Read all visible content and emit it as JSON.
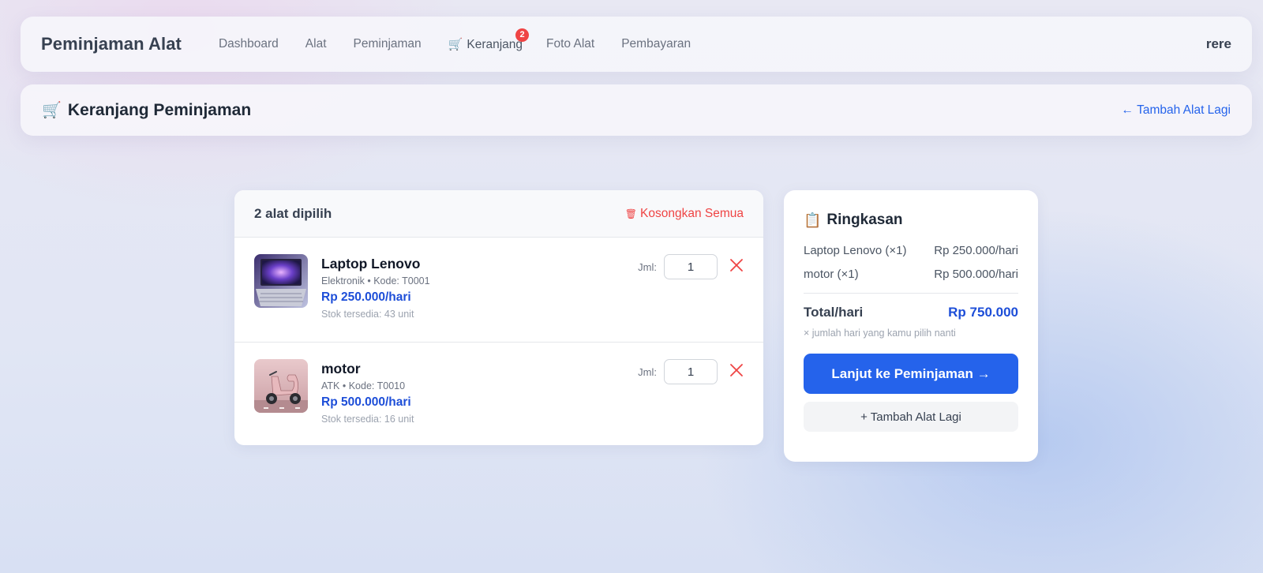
{
  "nav": {
    "brand": "Peminjaman Alat",
    "links": [
      "Dashboard",
      "Alat",
      "Peminjaman",
      "Keranjang",
      "Foto Alat",
      "Pembayaran"
    ],
    "cart_badge": "2",
    "user": "rere",
    "cart_icon": "shopping-cart-icon"
  },
  "page": {
    "title": "Keranjang Peminjaman",
    "back_link": "← Tambah Alat Lagi"
  },
  "cart": {
    "count_label": "2 alat dipilih",
    "clear_label": "Kosongkan Semua",
    "qty_label": "Jml:",
    "items": [
      {
        "name": "Laptop Lenovo",
        "meta": "Elektronik • Kode: T0001",
        "price": "Rp 250.000/hari",
        "stock": "Stok tersedia: 43 unit",
        "qty": "1",
        "image": "laptop-photo"
      },
      {
        "name": "motor",
        "meta": "ATK • Kode: T0010",
        "price": "Rp 500.000/hari",
        "stock": "Stok tersedia: 16 unit",
        "qty": "1",
        "image": "scooter-photo"
      }
    ]
  },
  "summary": {
    "title": "Ringkasan",
    "rows": [
      {
        "label": "Laptop Lenovo (×1)",
        "value": "Rp 250.000/hari"
      },
      {
        "label": "motor (×1)",
        "value": "Rp 500.000/hari"
      }
    ],
    "total_label": "Total/hari",
    "total_value": "Rp 750.000",
    "note": "× jumlah hari yang kamu pilih nanti",
    "primary_button": "Lanjut ke Peminjaman →",
    "secondary_button": "+ Tambah Alat Lagi"
  },
  "colors": {
    "accent": "#2563eb",
    "price": "#1d4ed8",
    "danger": "#ef4444"
  }
}
